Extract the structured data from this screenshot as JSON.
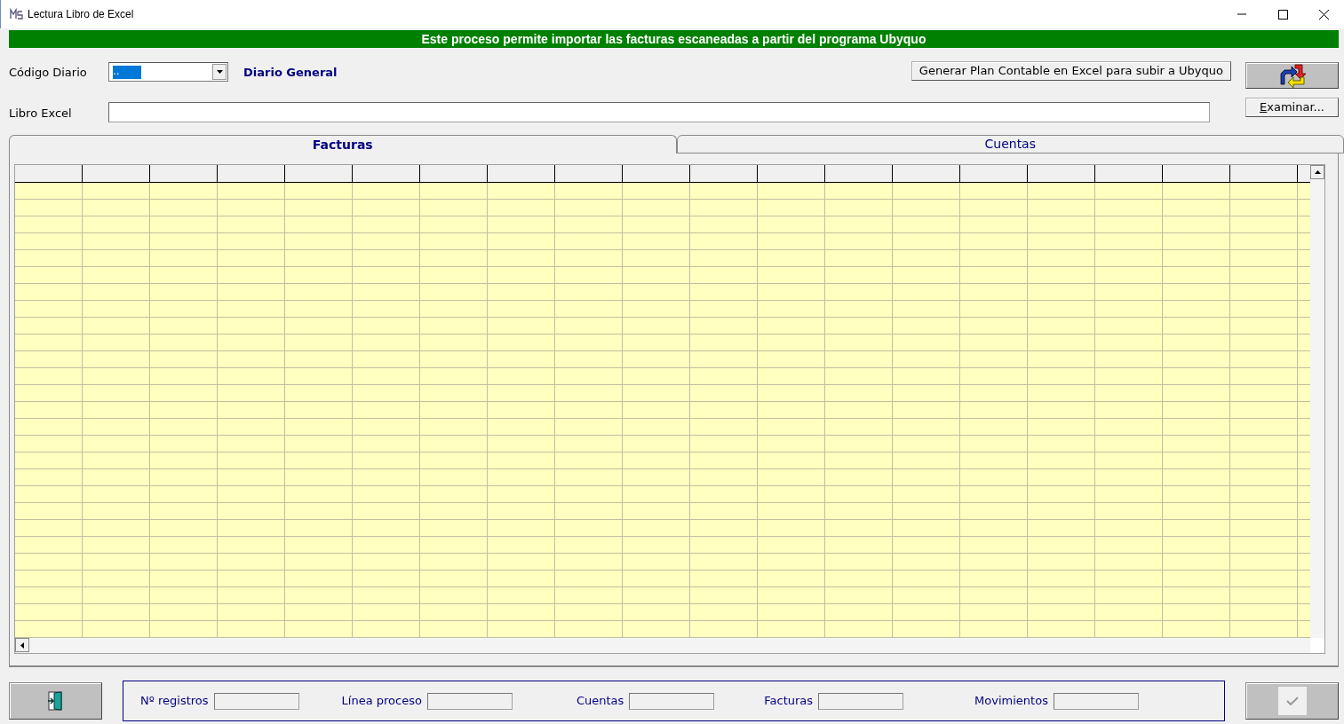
{
  "window": {
    "title": "Lectura Libro de Excel"
  },
  "banner": "Este proceso permite importar las facturas escaneadas a partir del programa Ubyquo",
  "diario": {
    "label": "Código Diario",
    "value": "..",
    "description": "Diario General"
  },
  "generate_button": "Generar Plan Contable en Excel para subir a Ubyquo",
  "libro": {
    "label": "Libro Excel"
  },
  "browse_button": "Examinar...",
  "tabs": [
    {
      "label": "Facturas",
      "selected": true
    },
    {
      "label": "Cuentas",
      "selected": false
    }
  ],
  "counters": [
    {
      "label": "Nº registros"
    },
    {
      "label": "Línea proceso"
    },
    {
      "label": "Cuentas"
    },
    {
      "label": "Facturas"
    },
    {
      "label": "Movimientos"
    }
  ],
  "accept_button": {
    "disabled": true
  }
}
